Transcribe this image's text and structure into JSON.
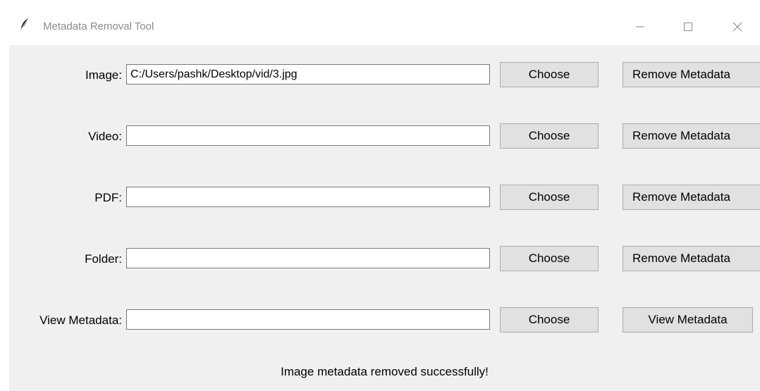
{
  "window": {
    "title": "Metadata Removal Tool",
    "minimize_glyph": "—",
    "maximize_glyph": "☐",
    "close_glyph": "✕"
  },
  "rows": [
    {
      "label": "Image:",
      "value": "C:/Users/pashk/Desktop/vid/3.jpg",
      "choose": "Choose",
      "action": "Remove Metadata"
    },
    {
      "label": "Video:",
      "value": "",
      "choose": "Choose",
      "action": "Remove Metadata"
    },
    {
      "label": "PDF:",
      "value": "",
      "choose": "Choose",
      "action": "Remove Metadata"
    },
    {
      "label": "Folder:",
      "value": "",
      "choose": "Choose",
      "action": "Remove Metadata"
    },
    {
      "label": "View Metadata:",
      "value": "",
      "choose": "Choose",
      "action": "View Metadata"
    }
  ],
  "status": "Image metadata removed successfully!",
  "colors": {
    "window_bg": "#f0f0f0",
    "button_bg": "#e1e1e1",
    "title_text": "#8a8a8a"
  }
}
